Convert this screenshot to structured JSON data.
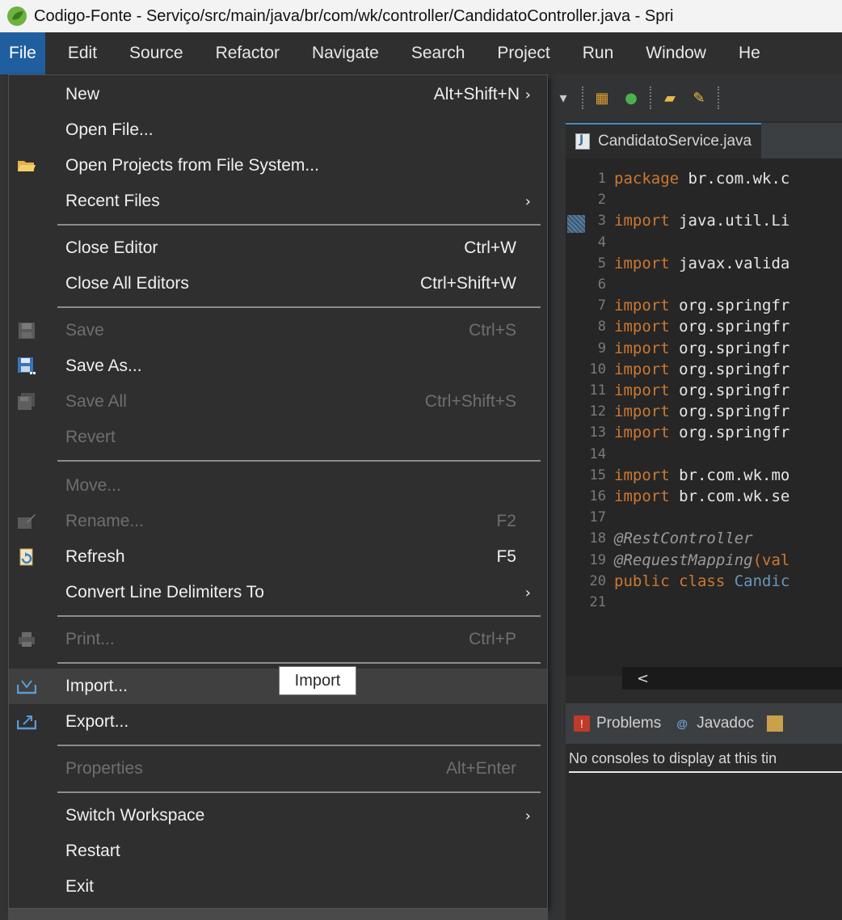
{
  "window": {
    "title": "Codigo-Fonte - Serviço/src/main/java/br/com/wk/controller/CandidatoController.java - Spri"
  },
  "menubar": {
    "items": [
      {
        "label": "File"
      },
      {
        "label": "Edit"
      },
      {
        "label": "Source"
      },
      {
        "label": "Refactor"
      },
      {
        "label": "Navigate"
      },
      {
        "label": "Search"
      },
      {
        "label": "Project"
      },
      {
        "label": "Run"
      },
      {
        "label": "Window"
      },
      {
        "label": "He"
      }
    ]
  },
  "file_menu": {
    "items": [
      {
        "label": "New",
        "shortcut": "Alt+Shift+N",
        "arrow": "›"
      },
      {
        "label": "Open File..."
      },
      {
        "label": "Open Projects from File System..."
      },
      {
        "label": "Recent Files",
        "arrow": "›"
      },
      {
        "label": "Close Editor",
        "shortcut": "Ctrl+W"
      },
      {
        "label": "Close All Editors",
        "shortcut": "Ctrl+Shift+W"
      },
      {
        "label": "Save",
        "shortcut": "Ctrl+S",
        "disabled": true
      },
      {
        "label": "Save As..."
      },
      {
        "label": "Save All",
        "shortcut": "Ctrl+Shift+S",
        "disabled": true
      },
      {
        "label": "Revert",
        "disabled": true
      },
      {
        "label": "Move...",
        "disabled": true
      },
      {
        "label": "Rename...",
        "shortcut": "F2",
        "disabled": true
      },
      {
        "label": "Refresh",
        "shortcut": "F5"
      },
      {
        "label": "Convert Line Delimiters To",
        "arrow": "›"
      },
      {
        "label": "Print...",
        "shortcut": "Ctrl+P",
        "disabled": true
      },
      {
        "label": "Import..."
      },
      {
        "label": "Export..."
      },
      {
        "label": "Properties",
        "shortcut": "Alt+Enter",
        "disabled": true
      },
      {
        "label": "Switch Workspace",
        "arrow": "›"
      },
      {
        "label": "Restart"
      },
      {
        "label": "Exit"
      }
    ],
    "tooltip": "Import"
  },
  "editor": {
    "tab": "CandidatoService.java",
    "lines": [
      {
        "n": "1",
        "kw": "package",
        "rest": " br.com.wk.c"
      },
      {
        "n": "2"
      },
      {
        "n": "3",
        "kw": "import",
        "rest": " java.util.Li"
      },
      {
        "n": "4"
      },
      {
        "n": "5",
        "kw": "import",
        "rest": " javax.valida"
      },
      {
        "n": "6"
      },
      {
        "n": "7",
        "kw": "import",
        "rest": " org.springfr"
      },
      {
        "n": "8",
        "kw": "import",
        "rest": " org.springfr"
      },
      {
        "n": "9",
        "kw": "import",
        "rest": " org.springfr"
      },
      {
        "n": "10",
        "kw": "import",
        "rest": " org.springfr"
      },
      {
        "n": "11",
        "kw": "import",
        "rest": " org.springfr"
      },
      {
        "n": "12",
        "kw": "import",
        "rest": " org.springfr"
      },
      {
        "n": "13",
        "kw": "import",
        "rest": " org.springfr"
      },
      {
        "n": "14"
      },
      {
        "n": "15",
        "kw": "import",
        "rest": " br.com.wk.mo"
      },
      {
        "n": "16",
        "kw": "import",
        "rest": " br.com.wk.se"
      },
      {
        "n": "17"
      },
      {
        "n": "18",
        "an": "@RestController"
      },
      {
        "n": "19",
        "an": "@RequestMapping",
        "tail": "(val"
      },
      {
        "n": "20",
        "kw": "public class",
        "blue": " Candic"
      },
      {
        "n": "21"
      }
    ],
    "scroll_arrow": "<"
  },
  "panel": {
    "tabs": [
      {
        "label": "Problems"
      },
      {
        "label": "Javadoc"
      }
    ],
    "message": "No consoles to display at this tin"
  }
}
